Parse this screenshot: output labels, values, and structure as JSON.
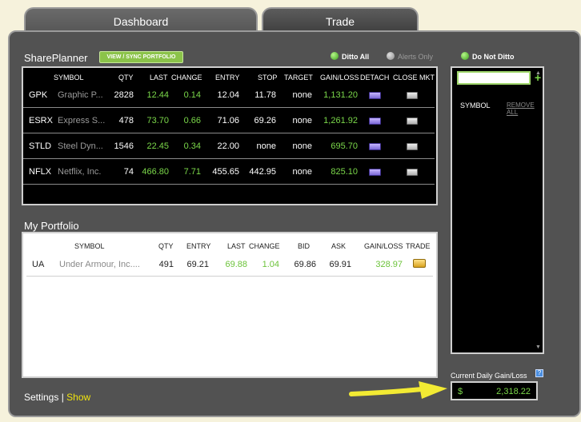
{
  "tabs": {
    "dashboard": "Dashboard",
    "trade": "Trade"
  },
  "shareplanner": {
    "title": "SharePlanner",
    "sync_button": "VIEW / SYNC PORTFOLIO",
    "ditto_all": "Ditto All",
    "alerts_only": "Alerts Only",
    "columns": [
      "SYMBOL",
      "QTY",
      "LAST",
      "CHANGE",
      "ENTRY",
      "STOP",
      "TARGET",
      "GAIN/LOSS",
      "DETACH",
      "CLOSE MKT"
    ],
    "rows": [
      {
        "symbol": "GPK",
        "name": "Graphic P...",
        "qty": "2828",
        "last": "12.44",
        "change": "0.14",
        "entry": "12.04",
        "stop": "11.78",
        "target": "none",
        "gain": "1,131.20"
      },
      {
        "symbol": "ESRX",
        "name": "Express S...",
        "qty": "478",
        "last": "73.70",
        "change": "0.66",
        "entry": "71.06",
        "stop": "69.26",
        "target": "none",
        "gain": "1,261.92"
      },
      {
        "symbol": "STLD",
        "name": "Steel Dyn...",
        "qty": "1546",
        "last": "22.45",
        "change": "0.34",
        "entry": "22.00",
        "stop": "none",
        "target": "none",
        "gain": "695.70"
      },
      {
        "symbol": "NFLX",
        "name": "Netflix, Inc.",
        "qty": "74",
        "last": "466.80",
        "change": "7.71",
        "entry": "455.65",
        "stop": "442.95",
        "target": "none",
        "gain": "825.10"
      }
    ]
  },
  "portfolio": {
    "title": "My Portfolio",
    "columns": [
      "SYMBOL",
      "QTY",
      "ENTRY",
      "LAST",
      "CHANGE",
      "BID",
      "ASK",
      "GAIN/LOSS",
      "TRADE"
    ],
    "rows": [
      {
        "symbol": "UA",
        "name": "Under Armour, Inc....",
        "qty": "491",
        "entry": "69.21",
        "last": "69.88",
        "change": "1.04",
        "bid": "69.86",
        "ask": "69.91",
        "gain": "328.97"
      }
    ]
  },
  "settings": {
    "label": "Settings",
    "separator": "|",
    "show": "Show"
  },
  "ditto": {
    "do_not_ditto": "Do Not Ditto",
    "plus": "+",
    "symbol_header": "SYMBOL",
    "remove_all": "REMOVE ALL"
  },
  "daily": {
    "label": "Current Daily Gain/Loss",
    "help": "?",
    "currency": "$",
    "value": "2,318.22"
  },
  "colors": {
    "accent_green": "#7bd84a",
    "panel": "#525252",
    "arrow": "#f2ea33"
  }
}
